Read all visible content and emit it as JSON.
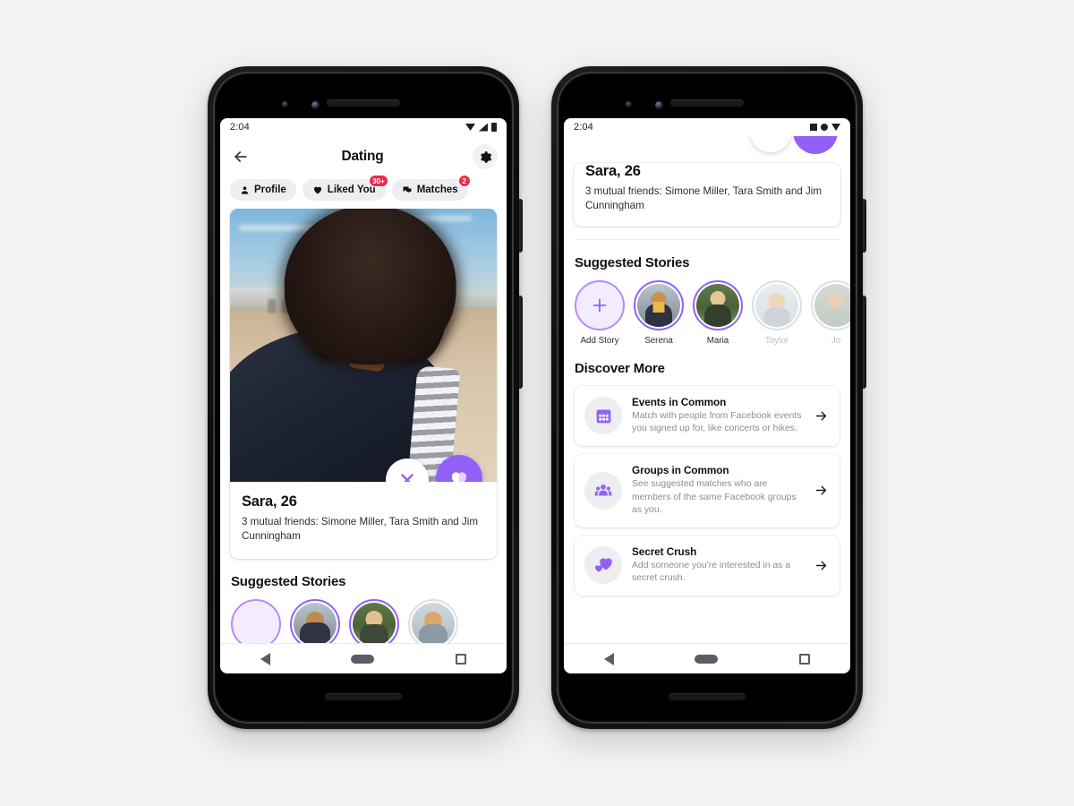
{
  "meta": {
    "accent": "#9360f7",
    "badge_color": "#f02849",
    "page_bg": "#f2f2f2"
  },
  "phone1": {
    "status": {
      "time": "2:04",
      "icons": [
        "wifi-icon",
        "signal-icon",
        "battery-icon"
      ]
    },
    "header": {
      "back_icon": "back-arrow-icon",
      "title": "Dating",
      "settings_icon": "gear-icon"
    },
    "tabs": [
      {
        "label": "Profile",
        "icon": "person-icon",
        "badge": ""
      },
      {
        "label": "Liked You",
        "icon": "heart-icon",
        "badge": "30+"
      },
      {
        "label": "Matches",
        "icon": "chat-bubbles-icon",
        "badge": "2"
      }
    ],
    "card": {
      "name": "Sara, 26",
      "mutual": "3 mutual friends: Simone Miller, Tara Smith and Jim Cunningham",
      "pass_icon": "close-x-icon",
      "like_icon": "heart-icon"
    },
    "stories_title": "Suggested Stories",
    "nav": {
      "back": "nav-back-icon",
      "home": "nav-home-icon",
      "recent": "nav-recent-icon"
    }
  },
  "phone2": {
    "status": {
      "time": "2:04",
      "icons": [
        "square-icon",
        "circle-icon",
        "triangle-icon"
      ]
    },
    "card": {
      "name": "Sara, 26",
      "mutual": "3 mutual friends: Simone Miller, Tara Smith and Jim Cunningham"
    },
    "stories_title": "Suggested Stories",
    "stories": [
      {
        "label": "Add Story",
        "ring": "purple",
        "type": "add",
        "faded": false
      },
      {
        "label": "Serena",
        "ring": "purple",
        "type": "photo",
        "faded": false
      },
      {
        "label": "Maria",
        "ring": "purple",
        "type": "photo",
        "faded": false
      },
      {
        "label": "Taylor",
        "ring": "gray",
        "type": "photo",
        "faded": true
      },
      {
        "label": "Jo",
        "ring": "gray",
        "type": "photo",
        "faded": true
      }
    ],
    "discover_title": "Discover More",
    "discover": [
      {
        "title": "Events in Common",
        "desc": "Match with people from Facebook events you signed up for, like concerts or hikes.",
        "icon": "calendar-grid-icon"
      },
      {
        "title": "Groups in Common",
        "desc": "See suggested matches who are members of the same Facebook groups as you.",
        "icon": "people-group-icon"
      },
      {
        "title": "Secret Crush",
        "desc": "Add someone you're interested in as a secret crush.",
        "icon": "two-hearts-icon"
      }
    ],
    "nav": {
      "back": "nav-back-icon",
      "home": "nav-home-icon",
      "recent": "nav-recent-icon"
    }
  }
}
